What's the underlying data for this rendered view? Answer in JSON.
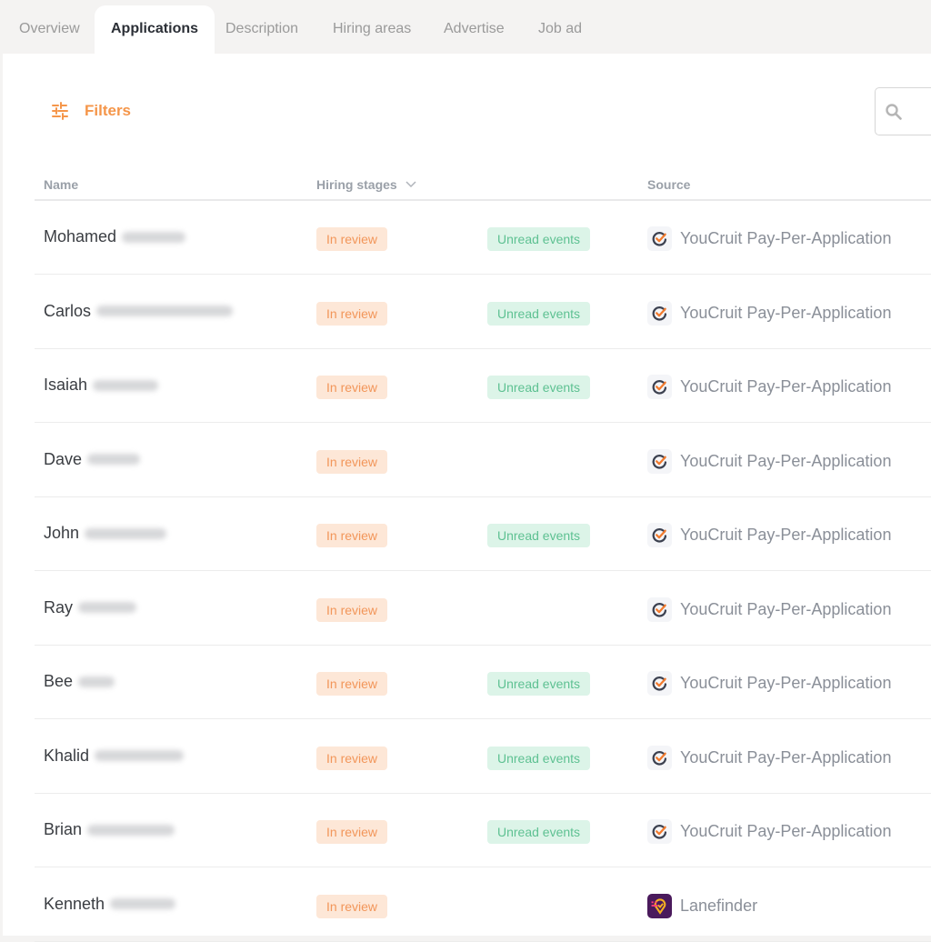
{
  "tabs": [
    {
      "label": "Overview",
      "active": false
    },
    {
      "label": "Applications",
      "active": true
    },
    {
      "label": "Description",
      "active": false
    },
    {
      "label": "Hiring areas",
      "active": false
    },
    {
      "label": "Advertise",
      "active": false
    },
    {
      "label": "Job ad",
      "active": false
    }
  ],
  "toolbar": {
    "filters_label": "Filters",
    "filters_icon": "sliders-icon",
    "search_icon": "search-icon",
    "search_value": ""
  },
  "table": {
    "columns": {
      "name": "Name",
      "hiring_stages": "Hiring stages",
      "source": "Source"
    },
    "rows": [
      {
        "first_name": "Mohamed",
        "surname_redacted": true,
        "stage": "In review",
        "event": "Unread events",
        "source": "YouCruit Pay-Per-Application",
        "source_icon": "youcruit-icon"
      },
      {
        "first_name": "Carlos",
        "surname_redacted": true,
        "stage": "In review",
        "event": "Unread events",
        "source": "YouCruit Pay-Per-Application",
        "source_icon": "youcruit-icon"
      },
      {
        "first_name": "Isaiah",
        "surname_redacted": true,
        "stage": "In review",
        "event": "Unread events",
        "source": "YouCruit Pay-Per-Application",
        "source_icon": "youcruit-icon"
      },
      {
        "first_name": "Dave",
        "surname_redacted": true,
        "stage": "In review",
        "event": "",
        "source": "YouCruit Pay-Per-Application",
        "source_icon": "youcruit-icon"
      },
      {
        "first_name": "John",
        "surname_redacted": true,
        "stage": "In review",
        "event": "Unread events",
        "source": "YouCruit Pay-Per-Application",
        "source_icon": "youcruit-icon"
      },
      {
        "first_name": "Ray",
        "surname_redacted": true,
        "stage": "In review",
        "event": "",
        "source": "YouCruit Pay-Per-Application",
        "source_icon": "youcruit-icon"
      },
      {
        "first_name": "Bee",
        "surname_redacted": true,
        "stage": "In review",
        "event": "Unread events",
        "source": "YouCruit Pay-Per-Application",
        "source_icon": "youcruit-icon"
      },
      {
        "first_name": "Khalid",
        "surname_redacted": true,
        "stage": "In review",
        "event": "Unread events",
        "source": "YouCruit Pay-Per-Application",
        "source_icon": "youcruit-icon"
      },
      {
        "first_name": "Brian",
        "surname_redacted": true,
        "stage": "In review",
        "event": "Unread events",
        "source": "YouCruit Pay-Per-Application",
        "source_icon": "youcruit-icon"
      },
      {
        "first_name": "Kenneth",
        "surname_redacted": true,
        "stage": "In review",
        "event": "",
        "source": "Lanefinder",
        "source_icon": "lanefinder-icon"
      }
    ]
  },
  "colors": {
    "accent": "#f5964a",
    "review_bg": "#fde7d7",
    "review_text": "#f2965a",
    "unread_bg": "#dcf4e8",
    "unread_text": "#5ec192",
    "lanefinder_bg": "#4a1a5c"
  }
}
